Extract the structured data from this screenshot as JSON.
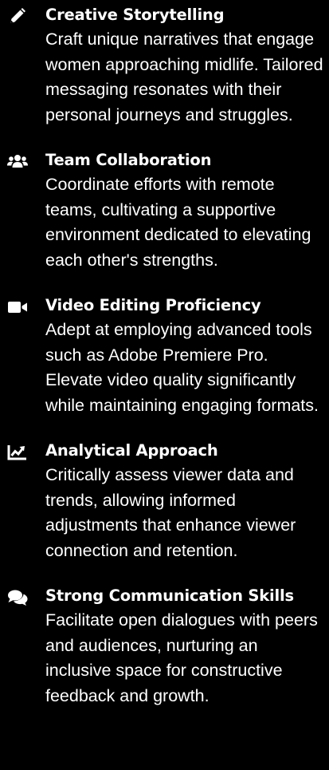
{
  "skills": [
    {
      "icon": "pencil-icon",
      "title": "Creative Storytelling",
      "description": "Craft unique narratives that engage women approaching midlife. Tailored messaging resonates with their personal journeys and struggles."
    },
    {
      "icon": "users-icon",
      "title": "Team Collaboration",
      "description": "Coordinate efforts with remote teams, cultivating a supportive environment dedicated to elevating each other's strengths."
    },
    {
      "icon": "video-camera-icon",
      "title": "Video Editing Proficiency",
      "description": "Adept at employing advanced tools such as Adobe Premiere Pro. Elevate video quality significantly while maintaining engaging formats."
    },
    {
      "icon": "chart-line-icon",
      "title": "Analytical Approach",
      "description": "Critically assess viewer data and trends, allowing informed adjustments that enhance viewer connection and retention."
    },
    {
      "icon": "comments-icon",
      "title": "Strong Communication Skills",
      "description": "Facilitate open dialogues with peers and audiences, nurturing an inclusive space for constructive feedback and growth."
    }
  ],
  "colors": {
    "background": "#000000",
    "text": "#ffffff"
  }
}
